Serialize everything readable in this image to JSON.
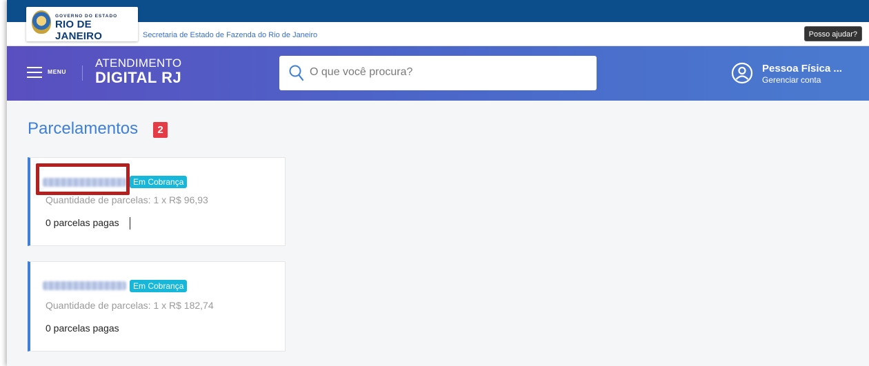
{
  "govbar": {
    "logo_small": "GOVERNO DO ESTADO",
    "logo_big": "RIO DE JANEIRO",
    "secretaria": "Secretaria de Estado de Fazenda do Rio de Janeiro",
    "help_button": "Posso ajudar?"
  },
  "header": {
    "menu_label": "MENU",
    "brand_top": "ATENDIMENTO",
    "brand_bottom": "DIGITAL RJ",
    "search_placeholder": "O que você procura?",
    "user_name": "Pessoa Física ...",
    "user_manage": "Gerenciar conta"
  },
  "page": {
    "title": "Parcelamentos",
    "count": "2"
  },
  "cards": [
    {
      "status": "Em Cobrança",
      "installments": "Quantidade de parcelas: 1 x R$ 96,93",
      "paid": "0 parcelas pagas"
    },
    {
      "status": "Em Cobrança",
      "installments": "Quantidade de parcelas: 1 x R$ 182,74",
      "paid": "0 parcelas pagas"
    }
  ],
  "icons": {
    "menu": "hamburger-icon",
    "search": "search-icon",
    "user": "user-circle-icon",
    "crest": "state-crest-icon"
  },
  "colors": {
    "topbar": "#0c4d8c",
    "header_start": "#5a4fc0",
    "header_end": "#4a7bd0",
    "accent": "#3f7fd8",
    "count_badge": "#e53b47",
    "status_badge": "#17b7d9",
    "highlight_box": "#b32020"
  }
}
